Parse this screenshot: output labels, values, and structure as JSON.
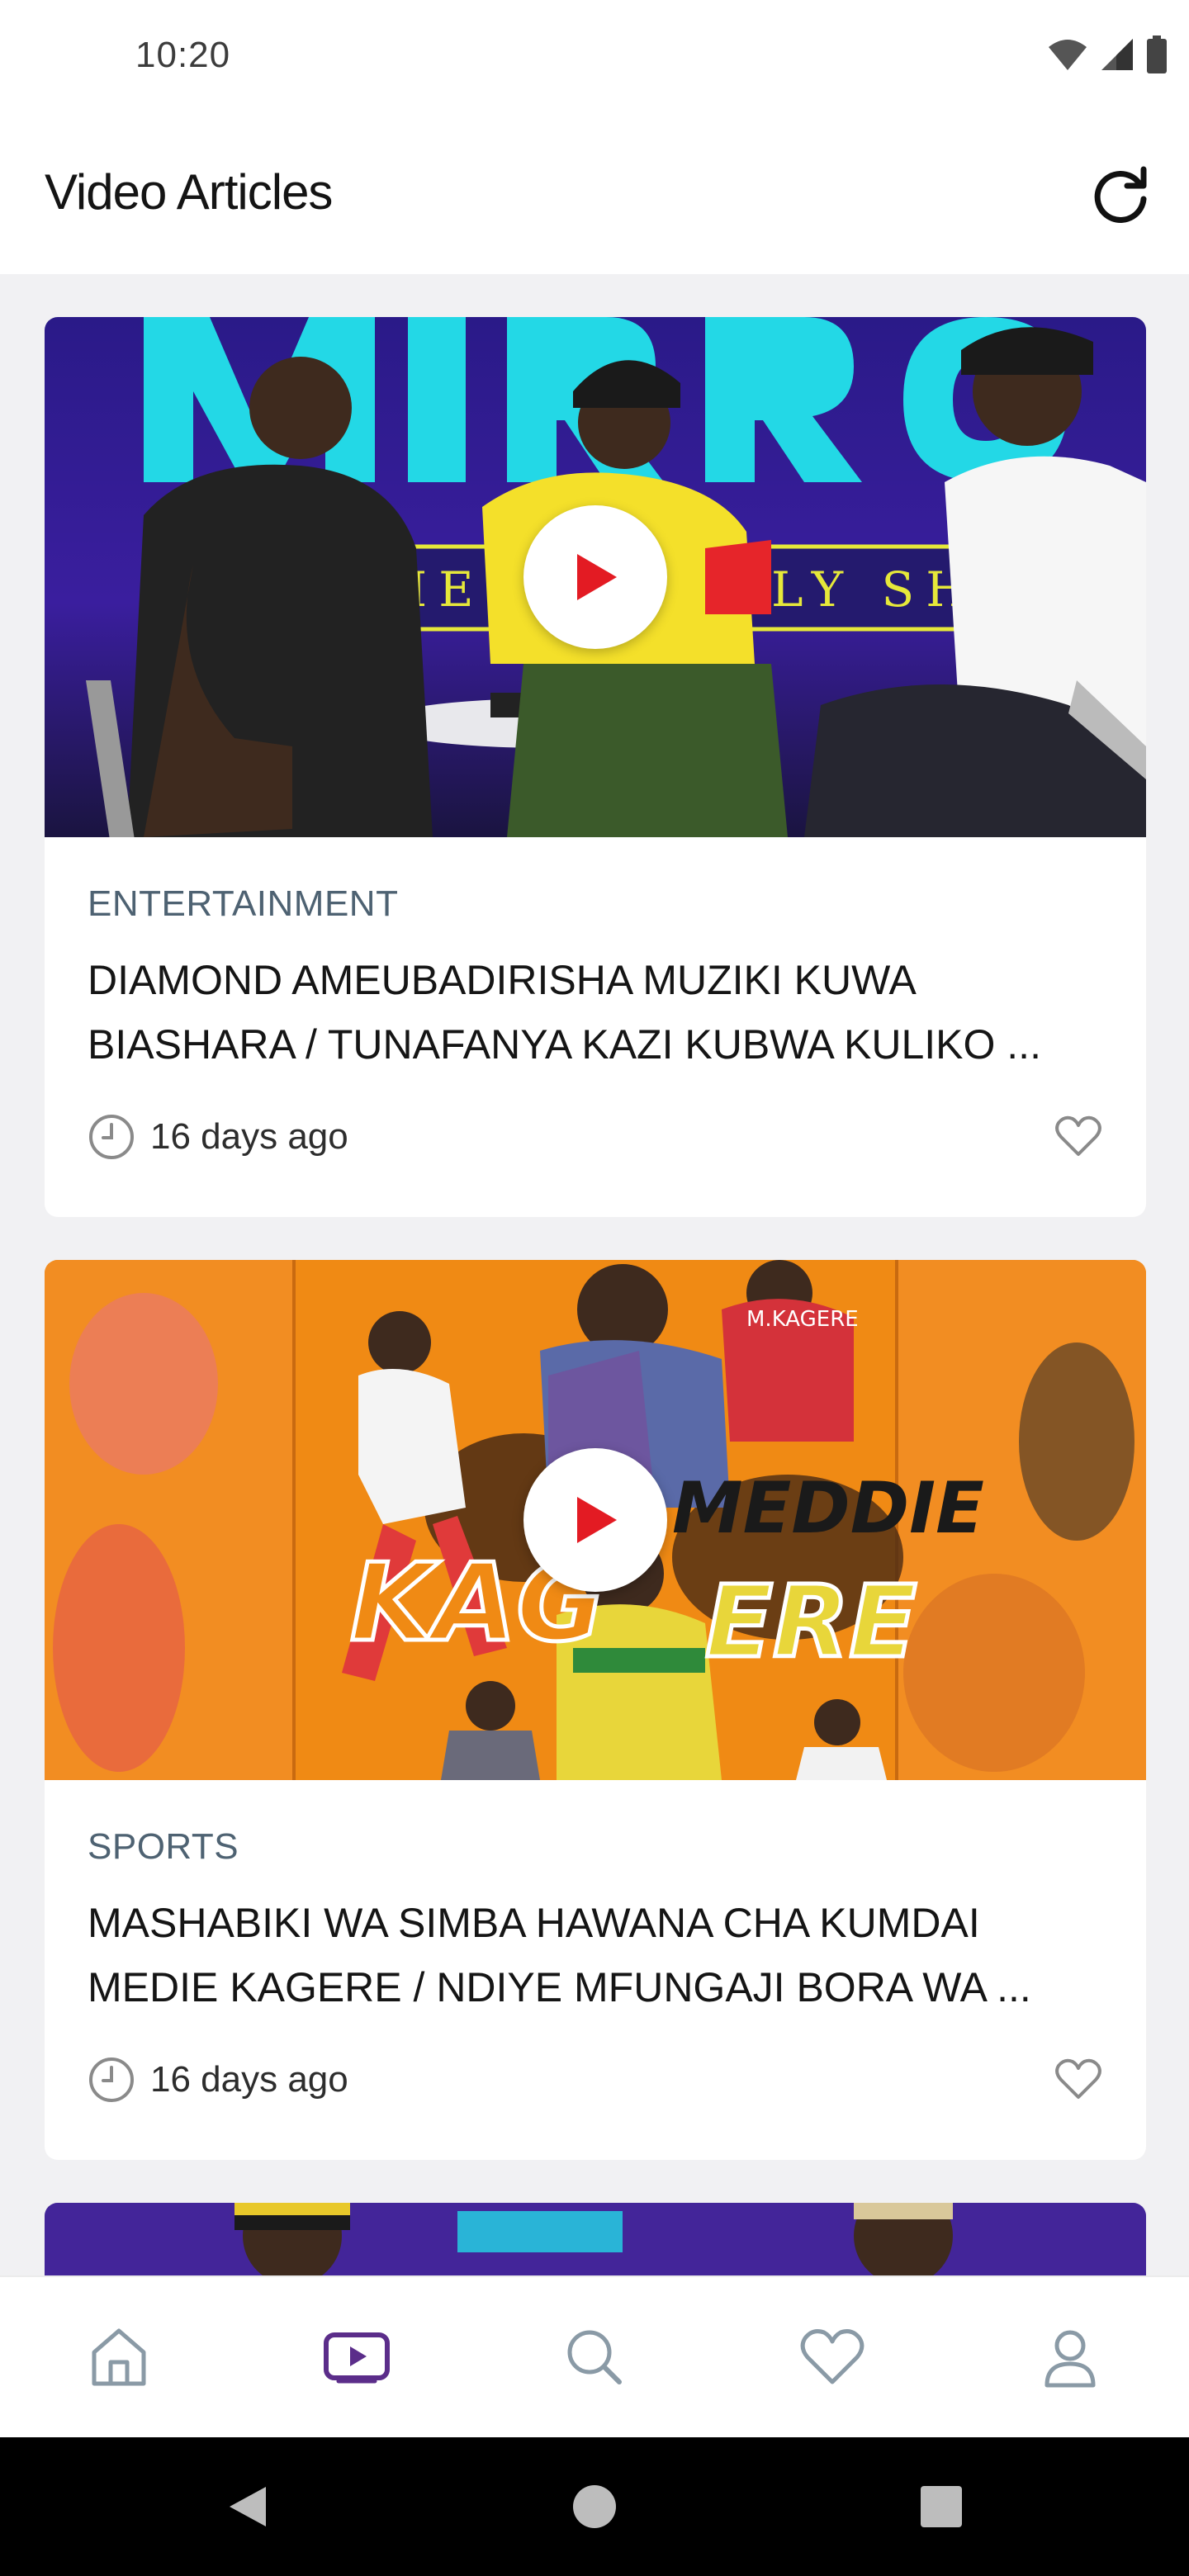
{
  "status_bar": {
    "time": "10:20"
  },
  "app_bar": {
    "title": "Video Articles"
  },
  "articles": [
    {
      "category": "ENTERTAINMENT",
      "title": "DIAMOND AMEUBADIRISHA MUZIKI KUWA BIASHARA / TUNAFANYA KAZI KUBWA KULIKO ...",
      "time": "16 days ago"
    },
    {
      "category": "SPORTS",
      "title": "MASHABIKI WA SIMBA HAWANA CHA KUMDAI MEDIE KAGERE / NDIYE MFUNGAJI BORA WA ...",
      "time": "16 days ago"
    }
  ],
  "bottom_nav": {
    "items": [
      {
        "icon": "home-icon",
        "active": false
      },
      {
        "icon": "video-icon",
        "active": true
      },
      {
        "icon": "search-icon",
        "active": false
      },
      {
        "icon": "heart-icon",
        "active": false
      },
      {
        "icon": "profile-icon",
        "active": false
      }
    ]
  },
  "colors": {
    "accent": "#5b2d8a",
    "category": "#4e6272",
    "nav_inactive": "#8a9aa6",
    "play_red": "#e31b23"
  }
}
